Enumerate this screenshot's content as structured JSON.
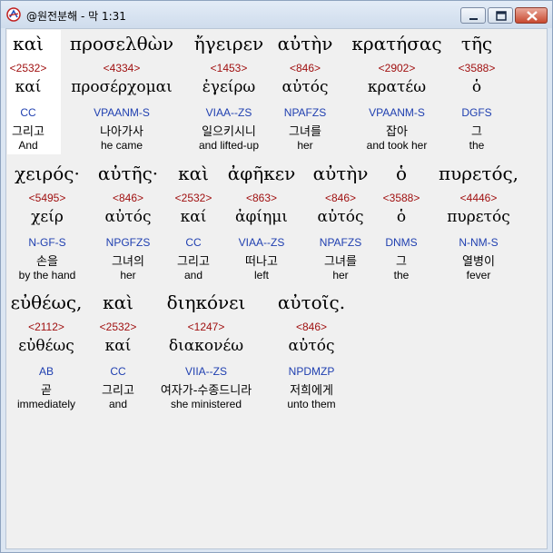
{
  "window": {
    "title": "@원전분해 - 막 1:31",
    "icon": "app-logo-icon",
    "controls": [
      "minimize-icon",
      "maximize-icon",
      "close-icon"
    ]
  },
  "rows": [
    {
      "words": [
        {
          "greek": "καὶ",
          "strong": "<2532>",
          "lemma": "καί",
          "morph": "CC",
          "korean": "그리고",
          "english": "And"
        },
        {
          "greek": "προσελθὼν",
          "strong": "<4334>",
          "lemma": "προσέρχομαι",
          "morph": "VPAANM-S",
          "korean": "나아가사",
          "english": "he came"
        },
        {
          "greek": "ἤγειρεν",
          "strong": "<1453>",
          "lemma": "ἐγείρω",
          "morph": "VIAA--ZS",
          "korean": "일으키시니",
          "english": "and lifted-up"
        },
        {
          "greek": "αὐτὴν",
          "strong": "<846>",
          "lemma": "αὐτός",
          "morph": "NPAFZS",
          "korean": "그녀를",
          "english": "her"
        },
        {
          "greek": "κρατήσας",
          "strong": "<2902>",
          "lemma": "κρατέω",
          "morph": "VPAANM-S",
          "korean": "잡아",
          "english": "and took her"
        },
        {
          "greek": "τῆς",
          "strong": "<3588>",
          "lemma": "ὁ",
          "morph": "DGFS",
          "korean": "그",
          "english": "the"
        }
      ]
    },
    {
      "words": [
        {
          "greek": "χειρός·",
          "strong": "<5495>",
          "lemma": "χείρ",
          "morph": "N-GF-S",
          "korean": "손을",
          "english": "by the hand"
        },
        {
          "greek": "αὐτῆς·",
          "strong": "<846>",
          "lemma": "αὐτός",
          "morph": "NPGFZS",
          "korean": "그녀의",
          "english": "her"
        },
        {
          "greek": "καὶ",
          "strong": "<2532>",
          "lemma": "καί",
          "morph": "CC",
          "korean": "그리고",
          "english": "and"
        },
        {
          "greek": "ἀφῆκεν",
          "strong": "<863>",
          "lemma": "ἀφίημι",
          "morph": "VIAA--ZS",
          "korean": "떠나고",
          "english": "left"
        },
        {
          "greek": "αὐτὴν",
          "strong": "<846>",
          "lemma": "αὐτός",
          "morph": "NPAFZS",
          "korean": "그녀를",
          "english": "her"
        },
        {
          "greek": "ὁ",
          "strong": "<3588>",
          "lemma": "ὁ",
          "morph": "DNMS",
          "korean": "그",
          "english": "the"
        },
        {
          "greek": "πυρετός,",
          "strong": "<4446>",
          "lemma": "πυρετός",
          "morph": "N-NM-S",
          "korean": "열병이",
          "english": "fever"
        }
      ]
    },
    {
      "words": [
        {
          "greek": "εὐθέως,",
          "strong": "<2112>",
          "lemma": "εὐθέως",
          "morph": "AB",
          "korean": "곧",
          "english": "immediately"
        },
        {
          "greek": "καὶ",
          "strong": "<2532>",
          "lemma": "καί",
          "morph": "CC",
          "korean": "그리고",
          "english": "and"
        },
        {
          "greek": "διηκόνει",
          "strong": "<1247>",
          "lemma": "διακονέω",
          "morph": "VIIA--ZS",
          "korean": "여자가-수종드니라",
          "english": "she ministered"
        },
        {
          "greek": "αὐτοῖς.",
          "strong": "<846>",
          "lemma": "αὐτός",
          "morph": "NPDMZP",
          "korean": "저희에게",
          "english": "unto them"
        }
      ]
    }
  ]
}
